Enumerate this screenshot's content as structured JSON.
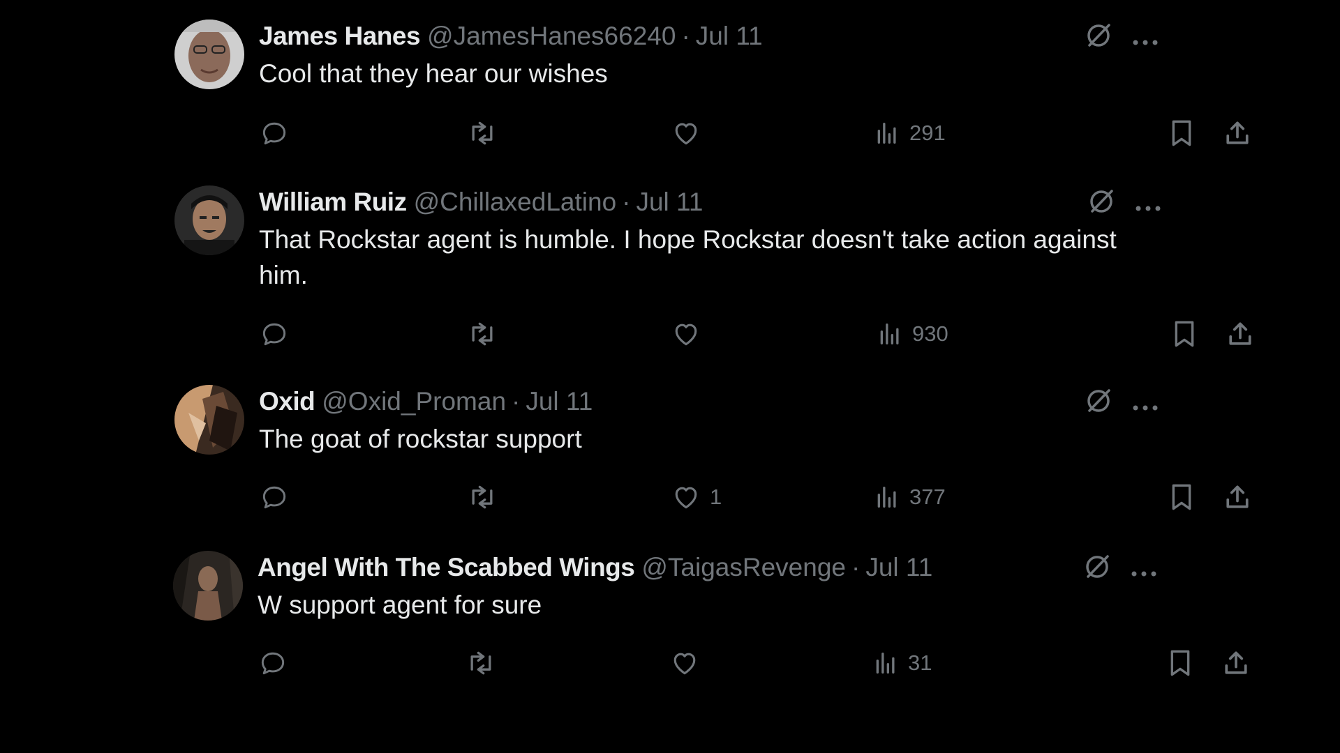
{
  "tweets": [
    {
      "name": "James Hanes",
      "handle": "@JamesHanes66240",
      "separator": "·",
      "date": "Jul 11",
      "text": "Cool that they hear our wishes",
      "like_count": "",
      "views": "291"
    },
    {
      "name": "William Ruiz",
      "handle": "@ChillaxedLatino",
      "separator": "·",
      "date": "Jul 11",
      "text": "That Rockstar agent is humble. I hope Rockstar doesn't take action against him.",
      "like_count": "",
      "views": "930"
    },
    {
      "name": "Oxid",
      "handle": "@Oxid_Proman",
      "separator": "·",
      "date": "Jul 11",
      "text": "The goat of rockstar support",
      "like_count": "1",
      "views": "377"
    },
    {
      "name": "Angel With The Scabbed Wings",
      "handle": "@TaigasRevenge",
      "separator": "·",
      "date": "Jul 11",
      "text": "W support agent for sure",
      "like_count": "",
      "views": "31"
    }
  ],
  "icons": {
    "grok": "grok-icon",
    "more": "more-icon",
    "reply": "reply-icon",
    "retweet": "retweet-icon",
    "like": "heart-icon",
    "views": "views-icon",
    "bookmark": "bookmark-icon",
    "share": "share-icon"
  },
  "colors": {
    "background": "#000000",
    "primary_text": "#e7e9ea",
    "secondary_text": "#71767b"
  }
}
